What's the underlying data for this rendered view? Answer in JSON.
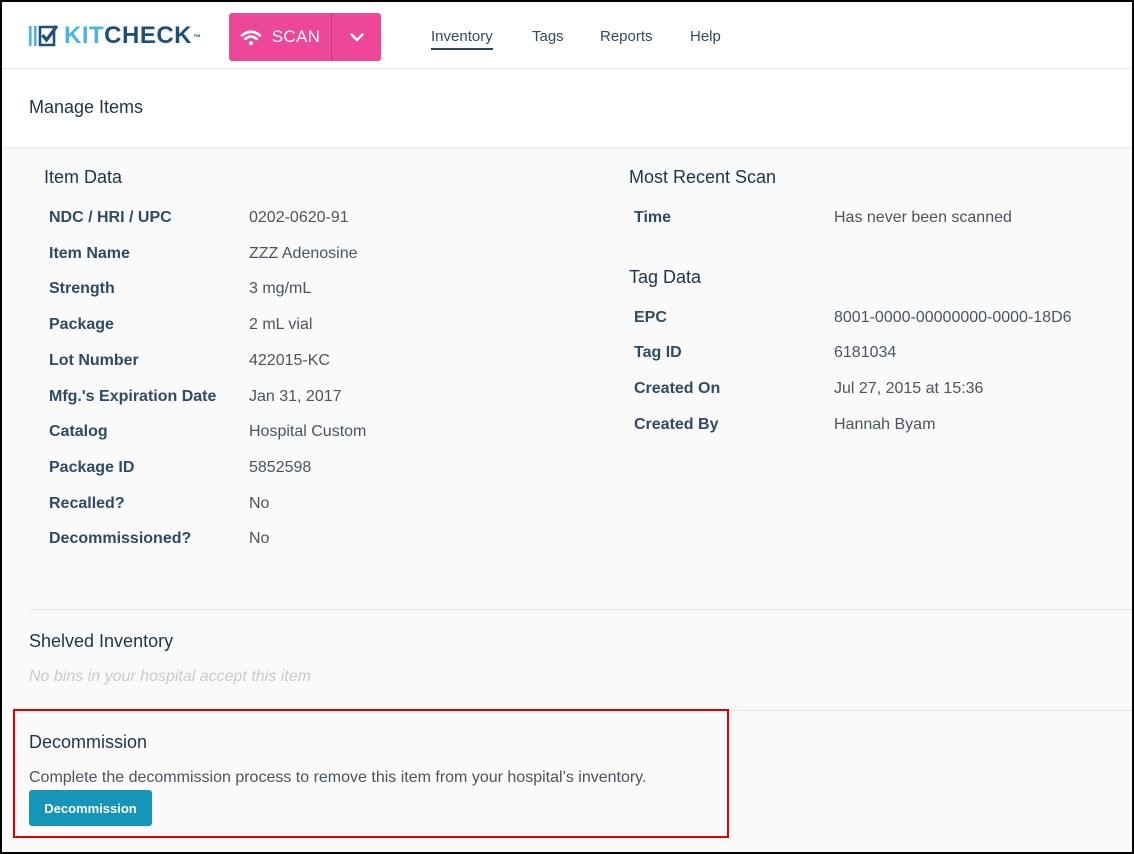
{
  "header": {
    "logo": {
      "part1": "KIT",
      "part2": "CHECK",
      "tm": "™"
    },
    "scan_label": "SCAN",
    "nav": [
      "Inventory",
      "Tags",
      "Reports",
      "Help"
    ]
  },
  "page_title": "Manage Items",
  "item_data": {
    "title": "Item Data",
    "rows": [
      {
        "label": "NDC / HRI / UPC",
        "value": "0202-0620-91"
      },
      {
        "label": "Item Name",
        "value": "ZZZ Adenosine"
      },
      {
        "label": "Strength",
        "value": "3 mg/mL"
      },
      {
        "label": "Package",
        "value": "2 mL vial"
      },
      {
        "label": "Lot Number",
        "value": "422015-KC"
      },
      {
        "label": "Mfg.'s Expiration Date",
        "value": "Jan 31, 2017"
      },
      {
        "label": "Catalog",
        "value": "Hospital Custom"
      },
      {
        "label": "Package ID",
        "value": "5852598"
      },
      {
        "label": "Recalled?",
        "value": "No"
      },
      {
        "label": "Decommissioned?",
        "value": "No"
      }
    ]
  },
  "recent_scan": {
    "title": "Most Recent Scan",
    "rows": [
      {
        "label": "Time",
        "value": "Has never been scanned"
      }
    ]
  },
  "tag_data": {
    "title": "Tag Data",
    "rows": [
      {
        "label": "EPC",
        "value": "8001-0000-00000000-0000-18D6"
      },
      {
        "label": "Tag ID",
        "value": "6181034"
      },
      {
        "label": "Created On",
        "value": "Jul 27, 2015 at 15:36"
      },
      {
        "label": "Created By",
        "value": "Hannah Byam"
      }
    ]
  },
  "shelved": {
    "title": "Shelved Inventory",
    "empty_note": "No bins in your hospital accept this item"
  },
  "decommission": {
    "title": "Decommission",
    "description": "Complete the decommission process to remove this item from your hospital’s inventory.",
    "button_label": "Decommission"
  },
  "colors": {
    "scan_pink": "#ec4799",
    "decommission_blue": "#1595b8",
    "highlight_red": "#e00000",
    "logo_light_blue": "#4db3e6",
    "logo_dark_blue": "#1e4f7a"
  },
  "icons": [
    "checkmark-logo-icon",
    "wifi-icon",
    "chevron-down-icon"
  ]
}
